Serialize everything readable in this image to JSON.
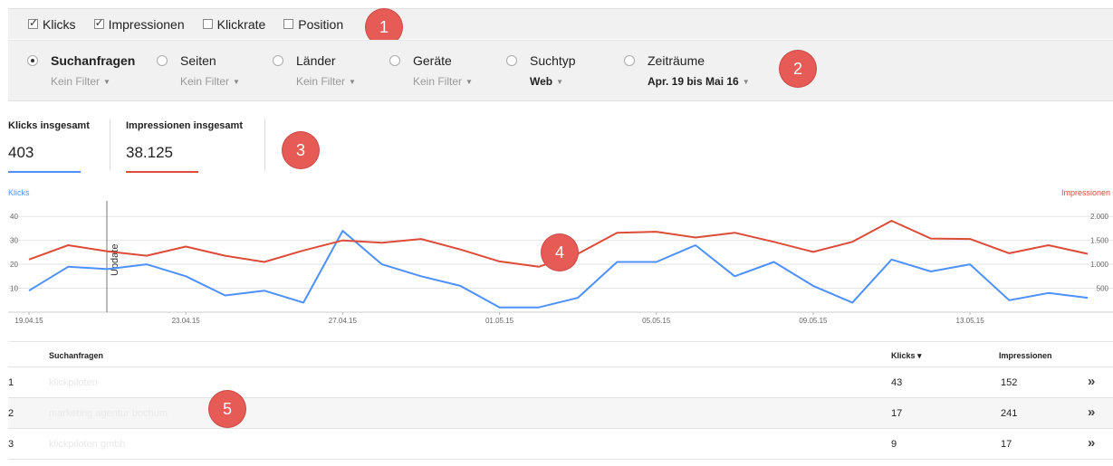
{
  "metrics": [
    {
      "label": "Klicks",
      "checked": true
    },
    {
      "label": "Impressionen",
      "checked": true
    },
    {
      "label": "Klickrate",
      "checked": false
    },
    {
      "label": "Position",
      "checked": false
    }
  ],
  "dimensions": [
    {
      "label": "Suchanfragen",
      "sub": "Kein Filter",
      "selected": true
    },
    {
      "label": "Seiten",
      "sub": "Kein Filter",
      "selected": false
    },
    {
      "label": "Länder",
      "sub": "Kein Filter",
      "selected": false
    },
    {
      "label": "Geräte",
      "sub": "Kein Filter",
      "selected": false
    },
    {
      "label": "Suchtyp",
      "sub": "Web",
      "selected": false
    },
    {
      "label": "Zeiträume",
      "sub": "Apr. 19 bis Mai 16",
      "selected": false
    }
  ],
  "markers": [
    "1",
    "2",
    "3",
    "4",
    "5"
  ],
  "totals": {
    "clicks_label": "Klicks insgesamt",
    "clicks_value": "403",
    "impr_label": "Impressionen insgesamt",
    "impr_value": "38.125"
  },
  "colors": {
    "clicks": "#4d90fe",
    "impressions": "#dd4b39"
  },
  "chart_data": {
    "type": "line",
    "left_axis_label": "Klicks",
    "right_axis_label": "Impressionen",
    "left_ticks": [
      "40",
      "30",
      "20",
      "10"
    ],
    "right_ticks": [
      "2.000",
      "1.500",
      "1.000",
      "500"
    ],
    "x_tick_labels": [
      "19.04.15",
      "23.04.15",
      "27.04.15",
      "01.05.15",
      "05.05.15",
      "09.05.15",
      "13.05.15"
    ],
    "annotation": "Update",
    "series": [
      {
        "name": "Klicks",
        "axis": "left",
        "values": [
          9,
          19,
          18,
          20,
          15,
          7,
          9,
          4,
          34,
          20,
          15,
          11,
          2,
          2,
          6,
          21,
          21,
          28,
          15,
          21,
          11,
          4,
          22,
          17,
          20,
          5,
          8,
          6
        ]
      },
      {
        "name": "Impressionen",
        "axis": "right",
        "values": [
          1100,
          1400,
          1270,
          1180,
          1370,
          1180,
          1050,
          1290,
          1500,
          1450,
          1530,
          1310,
          1060,
          950,
          1220,
          1660,
          1680,
          1560,
          1660,
          1470,
          1260,
          1470,
          1910,
          1540,
          1530,
          1230,
          1400,
          1220
        ]
      }
    ]
  },
  "table": {
    "headers": {
      "num": "",
      "query": "Suchanfragen",
      "clicks": "Klicks ▾",
      "impr": "Impressionen"
    },
    "rows": [
      {
        "num": "1",
        "query": "klickpiloten",
        "clicks": "43",
        "impr": "152"
      },
      {
        "num": "2",
        "query": "marketing agentur bochum",
        "clicks": "17",
        "impr": "241"
      },
      {
        "num": "3",
        "query": "klickpiloten gmbh",
        "clicks": "9",
        "impr": "17"
      }
    ]
  }
}
